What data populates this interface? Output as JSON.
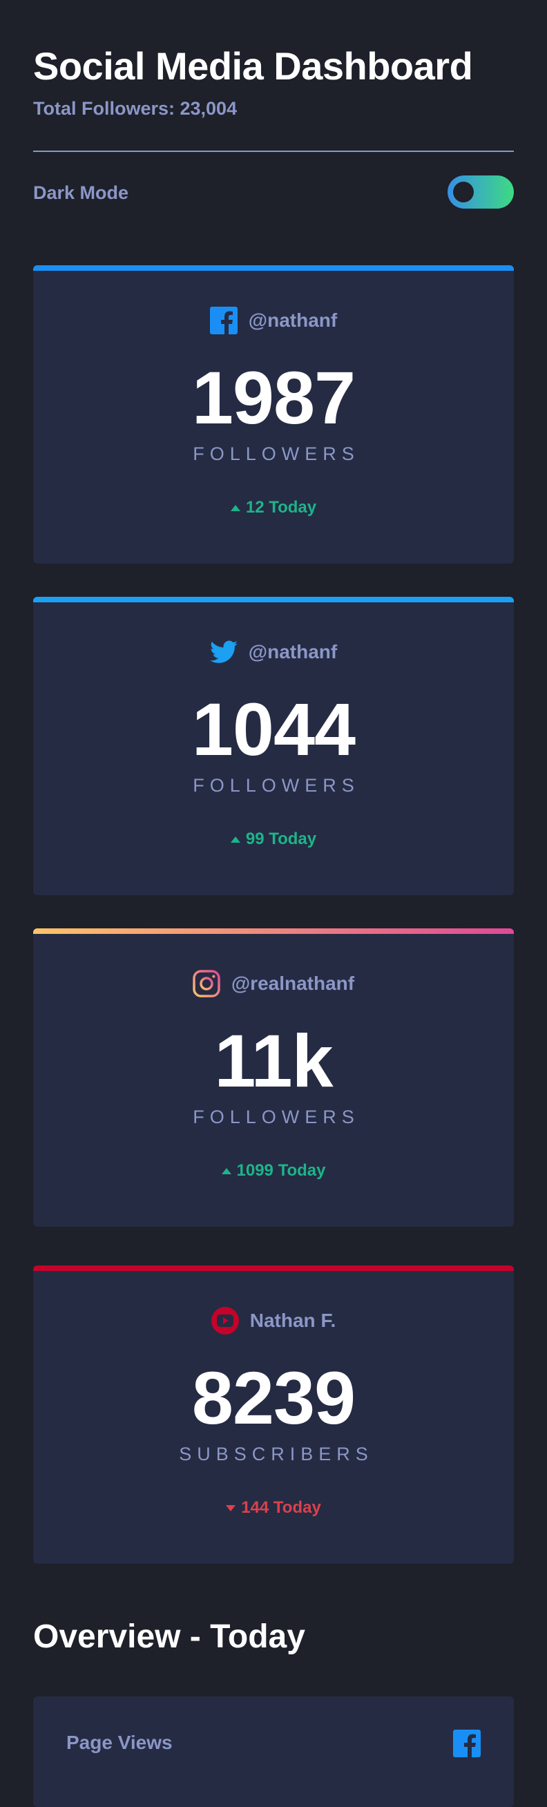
{
  "header": {
    "title": "Social Media Dashboard",
    "total_followers": "Total Followers: 23,004",
    "dark_mode_label": "Dark Mode",
    "dark_mode_enabled": true
  },
  "colors": {
    "background": "#1e202a",
    "card": "#252b43",
    "muted_text": "#8b97c6",
    "up": "#1db489",
    "down": "#dc414c",
    "facebook": "#198ff5",
    "twitter": "#1ca0f2",
    "instagram_gradient": [
      "#fdc468",
      "#df4996"
    ],
    "youtube": "#c4032b",
    "toggle_gradient": [
      "#378fe6",
      "#3eda82"
    ]
  },
  "cards": [
    {
      "platform": "facebook",
      "icon": "facebook-icon",
      "handle": "@nathanf",
      "count": "1987",
      "unit": "FOLLOWERS",
      "change": "12 Today",
      "direction": "up"
    },
    {
      "platform": "twitter",
      "icon": "twitter-icon",
      "handle": "@nathanf",
      "count": "1044",
      "unit": "FOLLOWERS",
      "change": "99 Today",
      "direction": "up"
    },
    {
      "platform": "instagram",
      "icon": "instagram-icon",
      "handle": "@realnathanf",
      "count": "11k",
      "unit": "FOLLOWERS",
      "change": "1099 Today",
      "direction": "up"
    },
    {
      "platform": "youtube",
      "icon": "youtube-icon",
      "handle": "Nathan F.",
      "count": "8239",
      "unit": "SUBSCRIBERS",
      "change": "144 Today",
      "direction": "down"
    }
  ],
  "overview": {
    "title": "Overview - Today",
    "items": [
      {
        "label": "Page Views",
        "icon": "facebook-icon"
      }
    ]
  }
}
